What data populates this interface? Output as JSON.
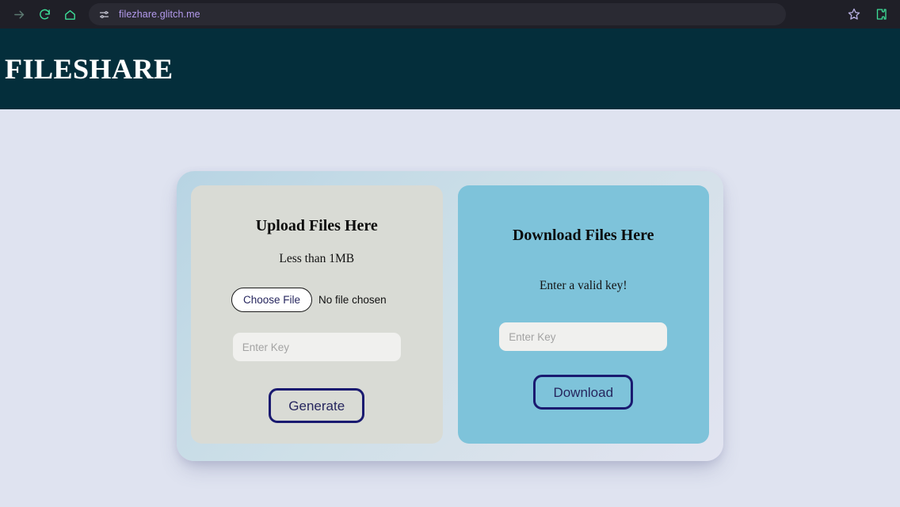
{
  "browser": {
    "nav": [
      {
        "name": "forward-arrow-icon",
        "label": "Forward"
      },
      {
        "name": "reload-icon",
        "label": "Reload"
      },
      {
        "name": "home-icon",
        "label": "Home"
      }
    ],
    "site_info_icon": "tune-sliders-icon",
    "url": "filezhare.glitch.me",
    "right_actions": [
      {
        "name": "bookmark-star-icon",
        "label": "Bookmark this tab"
      },
      {
        "name": "extensions-puzzle-icon",
        "label": "Extensions"
      }
    ],
    "colors": {
      "chrome_bg": "#1f1f27",
      "omnibox_bg": "#2a2a33",
      "url_text": "#b49bee",
      "icon_green": "#3ddc97",
      "star_purple": "#b6aee0"
    }
  },
  "header": {
    "title": "FILESHARE",
    "bg": "#042e3b"
  },
  "upload_card": {
    "title": "Upload Files Here",
    "note": "Less than 1MB",
    "choose_file_label": "Choose File",
    "file_status": "No file chosen",
    "key_placeholder": "Enter Key",
    "key_value": "",
    "submit_label": "Generate",
    "bg": "#d9dbd5"
  },
  "download_card": {
    "title": "Download Files Here",
    "note": "Enter a valid key!",
    "key_placeholder": "Enter Key",
    "key_value": "",
    "submit_label": "Download",
    "bg": "#7ec3da"
  },
  "page": {
    "bg": "#dfe3f0",
    "accent_navy": "#1a1a70"
  }
}
